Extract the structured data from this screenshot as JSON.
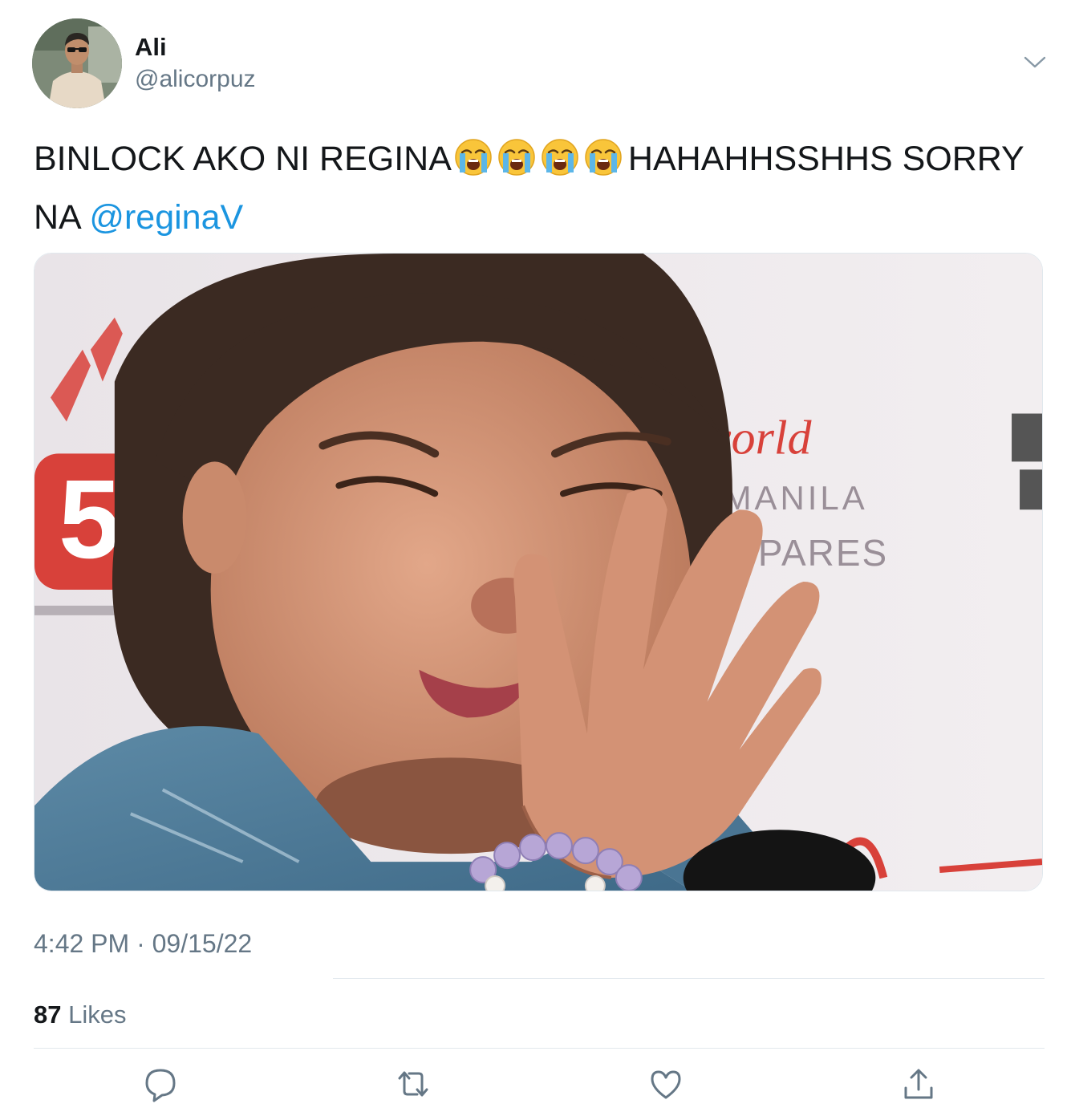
{
  "tweet": {
    "author": {
      "name": "Ali",
      "handle": "@alicorpuz",
      "avatar_icon": "profile-photo"
    },
    "text_before": "BINLOCK AKO NI REGINA",
    "emoji_name": "loudly-crying-face-icon",
    "emoji_count": 4,
    "text_after": "HAHAHHSSHHS SORRY NA ",
    "mention": "@reginaV",
    "media": {
      "description_icon": "photo-of-crying-child"
    },
    "timestamp": "4:42 PM · 09/15/22",
    "likes": {
      "count": "87",
      "label": "Likes"
    },
    "actions": [
      {
        "name": "reply",
        "icon": "speech-bubble-icon"
      },
      {
        "name": "retweet",
        "icon": "retweet-arrows-icon"
      },
      {
        "name": "like",
        "icon": "heart-icon"
      },
      {
        "name": "share",
        "icon": "share-upload-icon"
      }
    ]
  },
  "colors": {
    "text": "#14171a",
    "secondary": "#657786",
    "link": "#1b95e0",
    "divider": "#e1e8ed"
  }
}
